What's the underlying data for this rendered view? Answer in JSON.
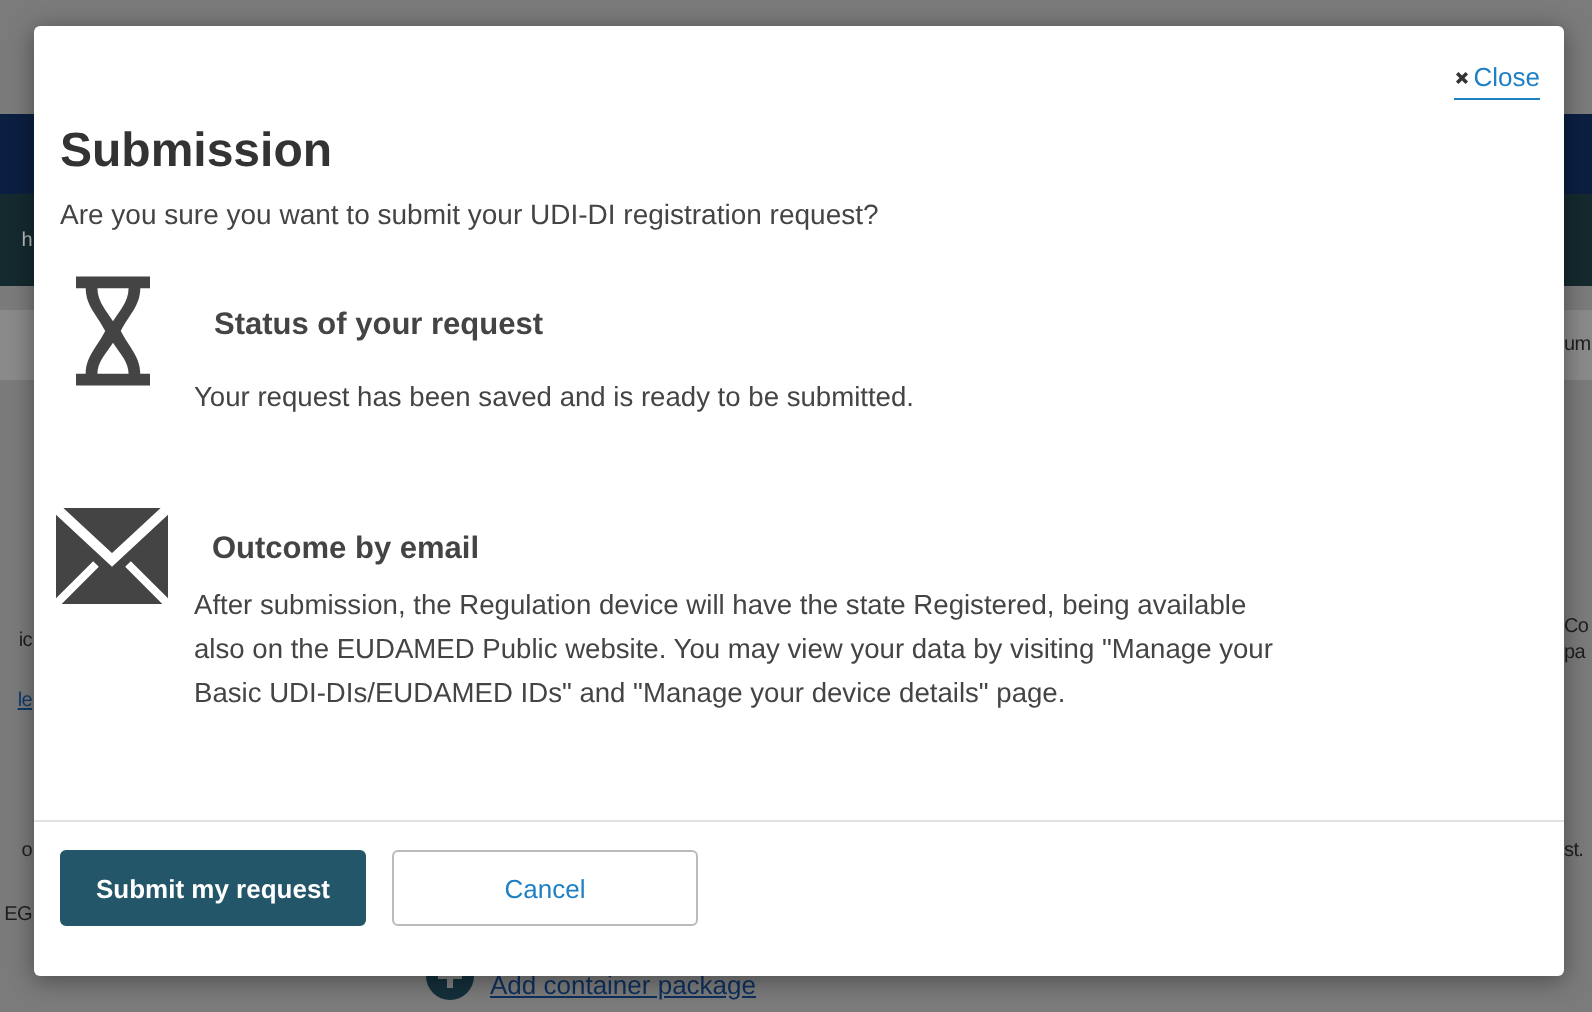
{
  "background": {
    "left_fragments": [
      "h",
      "ic",
      "le",
      "o",
      "EG"
    ],
    "right_fragments": [
      "um",
      "Co",
      "pa",
      "st."
    ],
    "link": "Add container package"
  },
  "dialog": {
    "close": "Close",
    "title": "Submission",
    "question": "Are you sure you want to submit your UDI-DI registration request?",
    "sections": [
      {
        "kind": "hourglass",
        "heading": "Status of your request",
        "text": "Your request has been saved and is ready to be submitted."
      },
      {
        "kind": "envelope",
        "heading": "Outcome by email",
        "text": "After submission, the Regulation device will have the state Registered, being available also on the EUDAMED Public website. You may view your data by visiting \"Manage your Basic UDI-DIs/EUDAMED IDs\" and \"Manage your device details\" page."
      }
    ],
    "buttons": [
      {
        "label": "Submit my request",
        "kind": "primary"
      },
      {
        "label": "Cancel",
        "kind": "secondary"
      }
    ]
  }
}
